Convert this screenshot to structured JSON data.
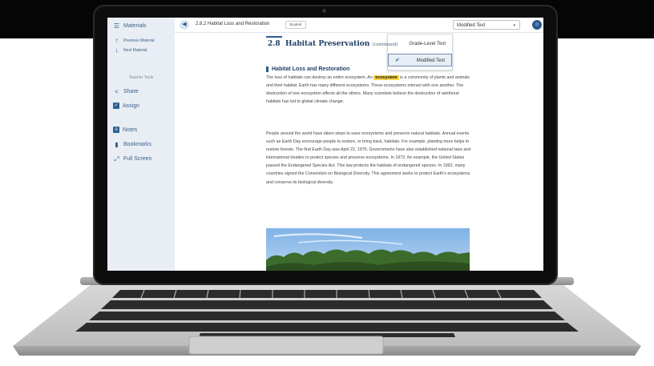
{
  "sidebar": {
    "materials_label": "Materials",
    "previous_label": "Previous Material",
    "next_label": "Next Material",
    "teacher_tools_label": "Teacher Tools",
    "share_label": "Share",
    "assign_label": "Assign",
    "notes_label": "Notes",
    "bookmarks_label": "Bookmarks",
    "fullscreen_label": "Full Screen"
  },
  "topbar": {
    "breadcrumb": "2.8.2 Habitat Loss and Restoration",
    "student_badge": "Student",
    "text_level_value": "Modified Text"
  },
  "text_level_menu": {
    "options": [
      "Grade-Level Text",
      "Modified Text"
    ],
    "selected": "Modified Text"
  },
  "content": {
    "section_number": "2.8",
    "section_title": "Habitat Preservation",
    "section_subtitle": "(continued)",
    "heading": "Habitat Loss and Restoration",
    "para1_before": "The loss of habitats can destroy an entire ecosystem. An ",
    "para1_highlight": "ecosystem",
    "para1_after": " is a community of plants and animals and their habitat. Earth has many different ecosystems. These ecosystems interact with one another. The destruction of one ecosystem affects all the others. Many scientists believe the destruction of rainforest habitats has led to global climate change.",
    "para2": "People around the world have taken steps to save ecosystems and preserve natural habitats. Annual events such as Earth Day encourage people to restore, or bring back, habitats. For example, planting trees helps to restore forests. The first Earth Day was April 22, 1970. Governments have also established national laws and international treaties to protect species and preserve ecosystems. In 1973, for example, the United States passed the Endangered Species Act. This law protects the habitats of endangered species. In 1992, many countries signed the Convention on Biological Diversity. This agreement seeks to protect Earth's ecosystems and conserve its biological diversity."
  },
  "colors": {
    "accent": "#2b5c8f",
    "highlight": "#f7d54a",
    "sidebar_bg": "#e9eef4"
  },
  "icons": [
    "list-icon",
    "arrow-up-icon",
    "arrow-down-icon",
    "share-icon",
    "assign-icon",
    "notes-icon",
    "bookmark-icon",
    "fullscreen-icon",
    "speaker-icon",
    "caret-down-icon",
    "checkmark-icon",
    "user-icon"
  ]
}
